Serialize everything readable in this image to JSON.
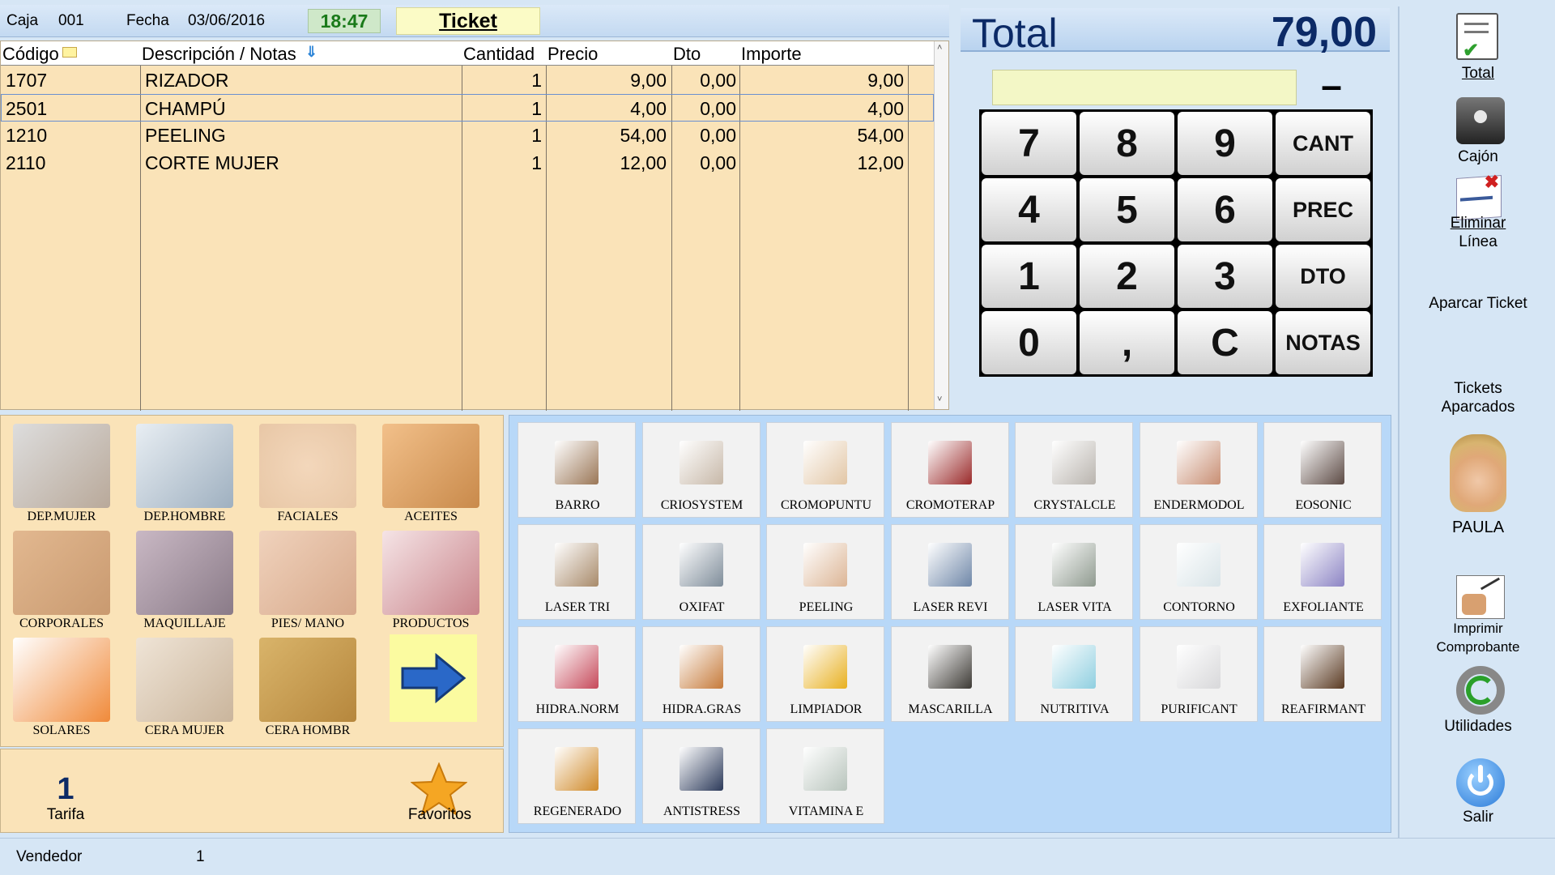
{
  "header": {
    "caja_label": "Caja",
    "caja_value": "001",
    "fecha_label": "Fecha",
    "fecha_value": "03/06/2016",
    "time": "18:47",
    "ticket_tab": "Ticket"
  },
  "table": {
    "columns": [
      "Código",
      "Descripción / Notas",
      "Cantidad",
      "Precio",
      "Dto",
      "Importe"
    ],
    "rows": [
      {
        "codigo": "1707",
        "descripcion": "RIZADOR",
        "cantidad": "1",
        "precio": "9,00",
        "dto": "0,00",
        "importe": "9,00"
      },
      {
        "codigo": "2501",
        "descripcion": "CHAMPÚ",
        "cantidad": "1",
        "precio": "4,00",
        "dto": "0,00",
        "importe": "4,00"
      },
      {
        "codigo": "1210",
        "descripcion": "PEELING",
        "cantidad": "1",
        "precio": "54,00",
        "dto": "0,00",
        "importe": "54,00"
      },
      {
        "codigo": "2110",
        "descripcion": "CORTE MUJER",
        "cantidad": "1",
        "precio": "12,00",
        "dto": "0,00",
        "importe": "12,00"
      }
    ],
    "scroll_up": "˄",
    "scroll_down": "˅"
  },
  "total": {
    "label": "Total",
    "value": "79,00"
  },
  "keypad": {
    "entry_value": "",
    "minus": "–",
    "keys": [
      "7",
      "8",
      "9",
      "CANT",
      "4",
      "5",
      "6",
      "PREC",
      "1",
      "2",
      "3",
      "DTO",
      "0",
      ",",
      "C",
      "NOTAS"
    ]
  },
  "sidebar": {
    "total": "Total",
    "cajon": "Cajón",
    "eliminar_1": "Eliminar",
    "eliminar_2": "Línea",
    "aparcar": "Aparcar Ticket",
    "tickets_1": "Tickets",
    "tickets_2": "Aparcados",
    "vendedor_name": "PAULA",
    "imprimir_1": "Imprimir",
    "imprimir_2": "Comprobante",
    "utilidades": "Utilidades",
    "salir": "Salir"
  },
  "families": [
    {
      "label": "DEP.MUJER",
      "color": "#b9a99a"
    },
    {
      "label": "DEP.HOMBRE",
      "color": "#9fb0c0"
    },
    {
      "label": "FACIALES",
      "color": "#e8c7a6"
    },
    {
      "label": "ACEITES",
      "color": "#c98a4b"
    },
    {
      "label": "CORPORALES",
      "color": "#c99a70"
    },
    {
      "label": "MAQUILLAJE",
      "color": "#8a7b88"
    },
    {
      "label": "PIES/ MANO",
      "color": "#d7a98b"
    },
    {
      "label": "PRODUCTOS",
      "color": "#c9848a"
    },
    {
      "label": "SOLARES",
      "color": "#f08a3a"
    },
    {
      "label": "CERA MUJER",
      "color": "#cab59c"
    },
    {
      "label": "CERA HOMBR",
      "color": "#b6873d"
    }
  ],
  "bottom_left": {
    "tarifa_value": "1",
    "tarifa_label": "Tarifa",
    "favoritos_label": "Favoritos"
  },
  "products": [
    {
      "label": "BARRO",
      "color": "#9a7656"
    },
    {
      "label": "CRIOSYSTEM",
      "color": "#c7b8a8"
    },
    {
      "label": "CROMOPUNTU",
      "color": "#e2c6a5"
    },
    {
      "label": "CROMOTERAP",
      "color": "#9a2a2a"
    },
    {
      "label": "CRYSTALCLE",
      "color": "#b9b4ae"
    },
    {
      "label": "ENDERMODOL",
      "color": "#c88e73"
    },
    {
      "label": "EOSONIC",
      "color": "#5c4a44"
    },
    {
      "label": "LASER TRI",
      "color": "#a88a6a"
    },
    {
      "label": "OXIFAT",
      "color": "#7f8d9a"
    },
    {
      "label": "PEELING",
      "color": "#dcb595"
    },
    {
      "label": "LASER REVI",
      "color": "#6f87a8"
    },
    {
      "label": "LASER VITA",
      "color": "#8f9a8f"
    },
    {
      "label": "CONTORNO",
      "color": "#d9e4e8"
    },
    {
      "label": "EXFOLIANTE",
      "color": "#8c84c4"
    },
    {
      "label": "HIDRA.NORM",
      "color": "#c6495a"
    },
    {
      "label": "HIDRA.GRAS",
      "color": "#c67a3a"
    },
    {
      "label": "LIMPIADOR",
      "color": "#e8b020"
    },
    {
      "label": "MASCARILLA",
      "color": "#3d3a35"
    },
    {
      "label": "NUTRITIVA",
      "color": "#8fcfe0"
    },
    {
      "label": "PURIFICANT",
      "color": "#d8d8da"
    },
    {
      "label": "REAFIRMANT",
      "color": "#5a3a22"
    },
    {
      "label": "REGENERADO",
      "color": "#d08a2a"
    },
    {
      "label": "ANTISTRESS",
      "color": "#2c3a5a"
    },
    {
      "label": "VITAMINA E",
      "color": "#b8c4bc"
    }
  ],
  "status": {
    "label": "Vendedor",
    "value": "1"
  }
}
